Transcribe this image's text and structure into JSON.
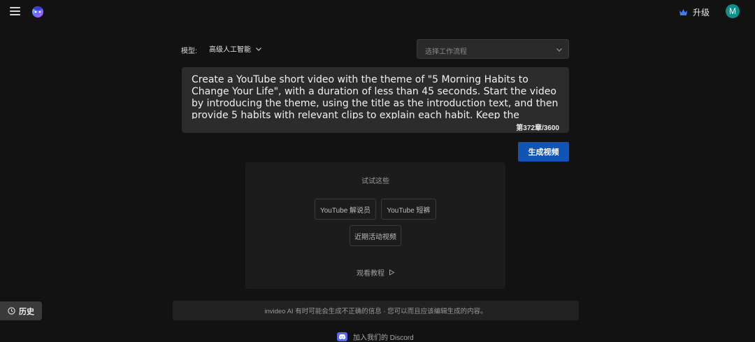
{
  "header": {
    "menu_icon": "hamburger-menu-icon",
    "logo_icon": "invideo-logo-icon",
    "upgrade_label": "升级",
    "upgrade_icon": "crown-icon",
    "avatar_initial": "M",
    "avatar_color": "#0f8f8a"
  },
  "controls": {
    "model_label": "模型:",
    "model_value": "高级人工智能",
    "workflow_placeholder": "选择工作流程"
  },
  "prompt": {
    "text": "Create a YouTube short video with the theme of \"5 Morning Habits to Change Your Life\", with a duration of less than 45 seconds. Start the video by introducing the theme, using the title as the introduction text, and then provide 5 habits with relevant clips to explain each habit. Keep the language",
    "char_count": "第372章/3600"
  },
  "generate_label": "生成视频",
  "accent_color": "#1254b6",
  "suggestions": {
    "heading": "试试这些",
    "chips": [
      "YouTube 解说员",
      "YouTube 短裤",
      "近期活动视频"
    ],
    "tutorial_label": "观看教程"
  },
  "history_label": "历史",
  "disclaimer": "invideo AI 有时可能会生成不正确的信息 · 您可以而且应该编辑生成的内容。",
  "discord_label": "加入我们的 Discord"
}
